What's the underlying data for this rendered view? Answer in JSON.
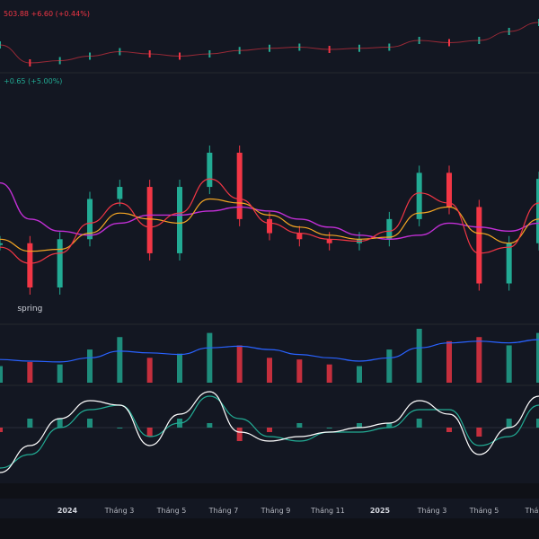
{
  "header": {
    "top_change": "503.88  +6.60 (+0.44%)",
    "mid_change": "+0.65 (+5.00%)"
  },
  "colors": {
    "background": "#131722",
    "up": "#22ab94",
    "down": "#f23645",
    "ma_fast": "#f23645",
    "ma_mid": "#f5a623",
    "ma_slow": "#c22fd6",
    "volume_ma": "#2962ff",
    "macd_line": "#ffffff",
    "signal_line": "#22ab94"
  },
  "chart_data": {
    "type": "line",
    "title": "",
    "x": [
      "2023-12",
      "2024-01",
      "2024-02",
      "2024-03",
      "2024-04",
      "2024-05",
      "2024-06",
      "2024-07",
      "2024-08",
      "2024-09",
      "2024-10",
      "2024-11",
      "2024-12",
      "2025-01",
      "2025-02",
      "2025-03",
      "2025-04",
      "2025-05",
      "2025-06"
    ],
    "xtick_labels": [
      "2024",
      "Tháng 3",
      "Tháng 5",
      "Tháng 7",
      "Tháng 9",
      "Tháng 11",
      "2025",
      "Tháng 3",
      "Tháng 5",
      "Tháng"
    ],
    "index_series": {
      "name": "",
      "values": [
        58,
        42,
        44,
        48,
        52,
        50,
        48,
        50,
        53,
        55,
        56,
        54,
        55,
        56,
        62,
        60,
        62,
        70,
        78
      ]
    },
    "price_series": {
      "name": "",
      "values": [
        60,
        38,
        62,
        82,
        88,
        55,
        88,
        105,
        72,
        65,
        62,
        60,
        62,
        72,
        95,
        78,
        40,
        60,
        92
      ],
      "ma_fast": [
        58,
        50,
        55,
        70,
        80,
        68,
        75,
        92,
        82,
        70,
        65,
        62,
        61,
        66,
        85,
        80,
        55,
        58,
        80
      ],
      "ma_mid": [
        62,
        56,
        57,
        65,
        75,
        72,
        70,
        82,
        80,
        74,
        68,
        64,
        62,
        63,
        75,
        78,
        65,
        60,
        72
      ],
      "ma_slow": [
        90,
        72,
        66,
        64,
        70,
        74,
        74,
        76,
        78,
        76,
        72,
        68,
        64,
        62,
        64,
        70,
        68,
        66,
        70
      ]
    },
    "annotation": "spring",
    "volume": {
      "values": [
        20,
        25,
        22,
        40,
        55,
        30,
        35,
        60,
        45,
        30,
        28,
        22,
        20,
        40,
        65,
        50,
        55,
        45,
        60
      ],
      "ma": [
        28,
        26,
        25,
        30,
        38,
        36,
        34,
        42,
        44,
        40,
        34,
        30,
        26,
        30,
        42,
        48,
        50,
        48,
        52
      ]
    },
    "macd": {
      "macd": [
        -10,
        -4,
        2,
        6,
        5,
        -4,
        3,
        8,
        -1,
        -3,
        -2,
        -1,
        0,
        1,
        6,
        3,
        -6,
        0,
        7
      ],
      "signal": [
        -9,
        -6,
        0,
        4,
        5,
        -2,
        1,
        7,
        2,
        -2,
        -3,
        -1,
        -1,
        0,
        4,
        4,
        -4,
        -2,
        5
      ],
      "histogram": [
        -1,
        2,
        2,
        2,
        0,
        -2,
        2,
        1,
        -3,
        -1,
        1,
        0,
        1,
        1,
        2,
        -1,
        -2,
        2,
        2
      ]
    }
  }
}
